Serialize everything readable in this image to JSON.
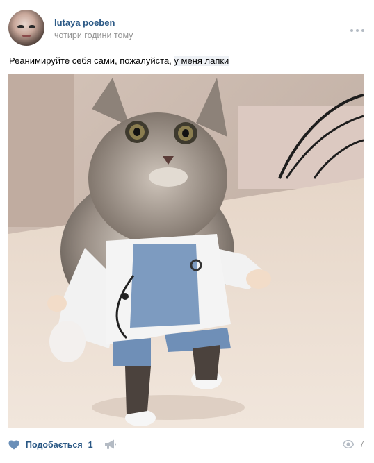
{
  "post": {
    "author": "lutaya poeben",
    "time": "чотири години тому",
    "text_main": "Реанимируйте себя сами, пожалуйста, ",
    "text_highlight": "у меня лапки"
  },
  "footer": {
    "like_label": "Подобається",
    "like_count": "1",
    "views_count": "7"
  },
  "colors": {
    "link": "#2a5885",
    "muted": "#939393",
    "icon": "#b4bbc4"
  },
  "icons": {
    "more": "more-icon",
    "like": "heart-icon",
    "share": "megaphone-icon",
    "views": "eye-icon"
  }
}
